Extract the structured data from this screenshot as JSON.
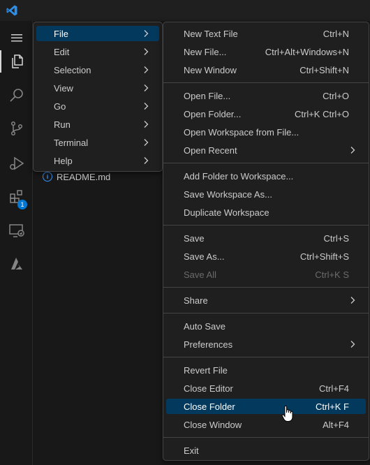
{
  "menubar": {
    "items": [
      {
        "label": "File",
        "submenu": true,
        "highlighted": true
      },
      {
        "label": "Edit",
        "submenu": true
      },
      {
        "label": "Selection",
        "submenu": true
      },
      {
        "label": "View",
        "submenu": true
      },
      {
        "label": "Go",
        "submenu": true
      },
      {
        "label": "Run",
        "submenu": true
      },
      {
        "label": "Terminal",
        "submenu": true
      },
      {
        "label": "Help",
        "submenu": true
      }
    ]
  },
  "file_menu": {
    "items": [
      {
        "label": "New Text File",
        "shortcut": "Ctrl+N"
      },
      {
        "label": "New File...",
        "shortcut": "Ctrl+Alt+Windows+N"
      },
      {
        "label": "New Window",
        "shortcut": "Ctrl+Shift+N"
      },
      {
        "label": "Open File...",
        "shortcut": "Ctrl+O"
      },
      {
        "label": "Open Folder...",
        "shortcut": "Ctrl+K Ctrl+O"
      },
      {
        "label": "Open Workspace from File...",
        "shortcut": ""
      },
      {
        "label": "Open Recent",
        "shortcut": "",
        "submenu": true
      },
      {
        "label": "Add Folder to Workspace...",
        "shortcut": ""
      },
      {
        "label": "Save Workspace As...",
        "shortcut": ""
      },
      {
        "label": "Duplicate Workspace",
        "shortcut": ""
      },
      {
        "label": "Save",
        "shortcut": "Ctrl+S"
      },
      {
        "label": "Save As...",
        "shortcut": "Ctrl+Shift+S"
      },
      {
        "label": "Save All",
        "shortcut": "Ctrl+K S",
        "disabled": true
      },
      {
        "label": "Share",
        "shortcut": "",
        "submenu": true
      },
      {
        "label": "Auto Save",
        "shortcut": ""
      },
      {
        "label": "Preferences",
        "shortcut": "",
        "submenu": true
      },
      {
        "label": "Revert File",
        "shortcut": ""
      },
      {
        "label": "Close Editor",
        "shortcut": "Ctrl+F4"
      },
      {
        "label": "Close Folder",
        "shortcut": "Ctrl+K F",
        "highlighted": true
      },
      {
        "label": "Close Window",
        "shortcut": "Alt+F4"
      },
      {
        "label": "Exit",
        "shortcut": ""
      }
    ]
  },
  "explorer": {
    "file_name": "README.md"
  },
  "activity_bar": {
    "extensions_badge": "1",
    "icons": [
      "explorer-icon",
      "search-icon",
      "source-control-icon",
      "run-debug-icon",
      "extensions-icon",
      "remote-explorer-icon",
      "azure-icon"
    ]
  },
  "colors": {
    "accent": "#0078d4",
    "highlight": "#04395e",
    "menu_bg": "#1f1f1f",
    "text": "#cccccc",
    "disabled": "#6b6b6b"
  }
}
